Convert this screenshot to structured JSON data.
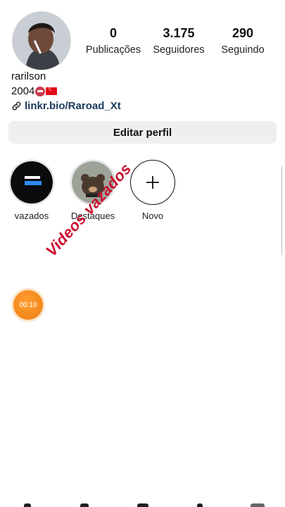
{
  "profile": {
    "username": "rarilson",
    "bio_text": "2004",
    "link": "linkr.bio/Raroad_Xt",
    "edit_button": "Editar perfil"
  },
  "stats": [
    {
      "value": "0",
      "label": "Publicações"
    },
    {
      "value": "3.175",
      "label": "Seguidores"
    },
    {
      "value": "290",
      "label": "Seguindo"
    }
  ],
  "highlights": [
    {
      "label": "vazados"
    },
    {
      "label": "Destaques"
    },
    {
      "label": "Novo"
    }
  ],
  "overlay": {
    "watermark": "Videos vazados",
    "timer": "00:10"
  },
  "colors": {
    "accent_red": "#c8102e",
    "timer_orange": "#f08a1c",
    "button_bg": "#efefef"
  }
}
